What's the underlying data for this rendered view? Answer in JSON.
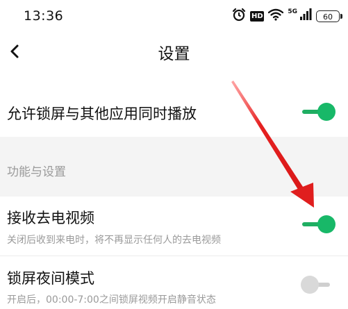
{
  "status_bar": {
    "time": "13:36",
    "hd_label": "HD",
    "network_label": "5G",
    "battery": "60"
  },
  "header": {
    "title": "设置",
    "back_icon": "chevron-left-icon"
  },
  "settings": {
    "simultaneous_playback": {
      "label": "允许锁屏与其他应用同时播放",
      "enabled": true
    },
    "section_label": "功能与设置",
    "receive_call_video": {
      "label": "接收去电视频",
      "description": "关闭后收到来电时，将不再显示任何人的去电视频",
      "enabled": true
    },
    "lock_night_mode": {
      "label": "锁屏夜间模式",
      "description": "开启后，00:00-7:00之间锁屏视频开启静音状态",
      "enabled": false
    }
  },
  "colors": {
    "toggle_on": "#18b868",
    "toggle_off": "#d9d9d9",
    "annotation_arrow": "#e01e1e"
  }
}
